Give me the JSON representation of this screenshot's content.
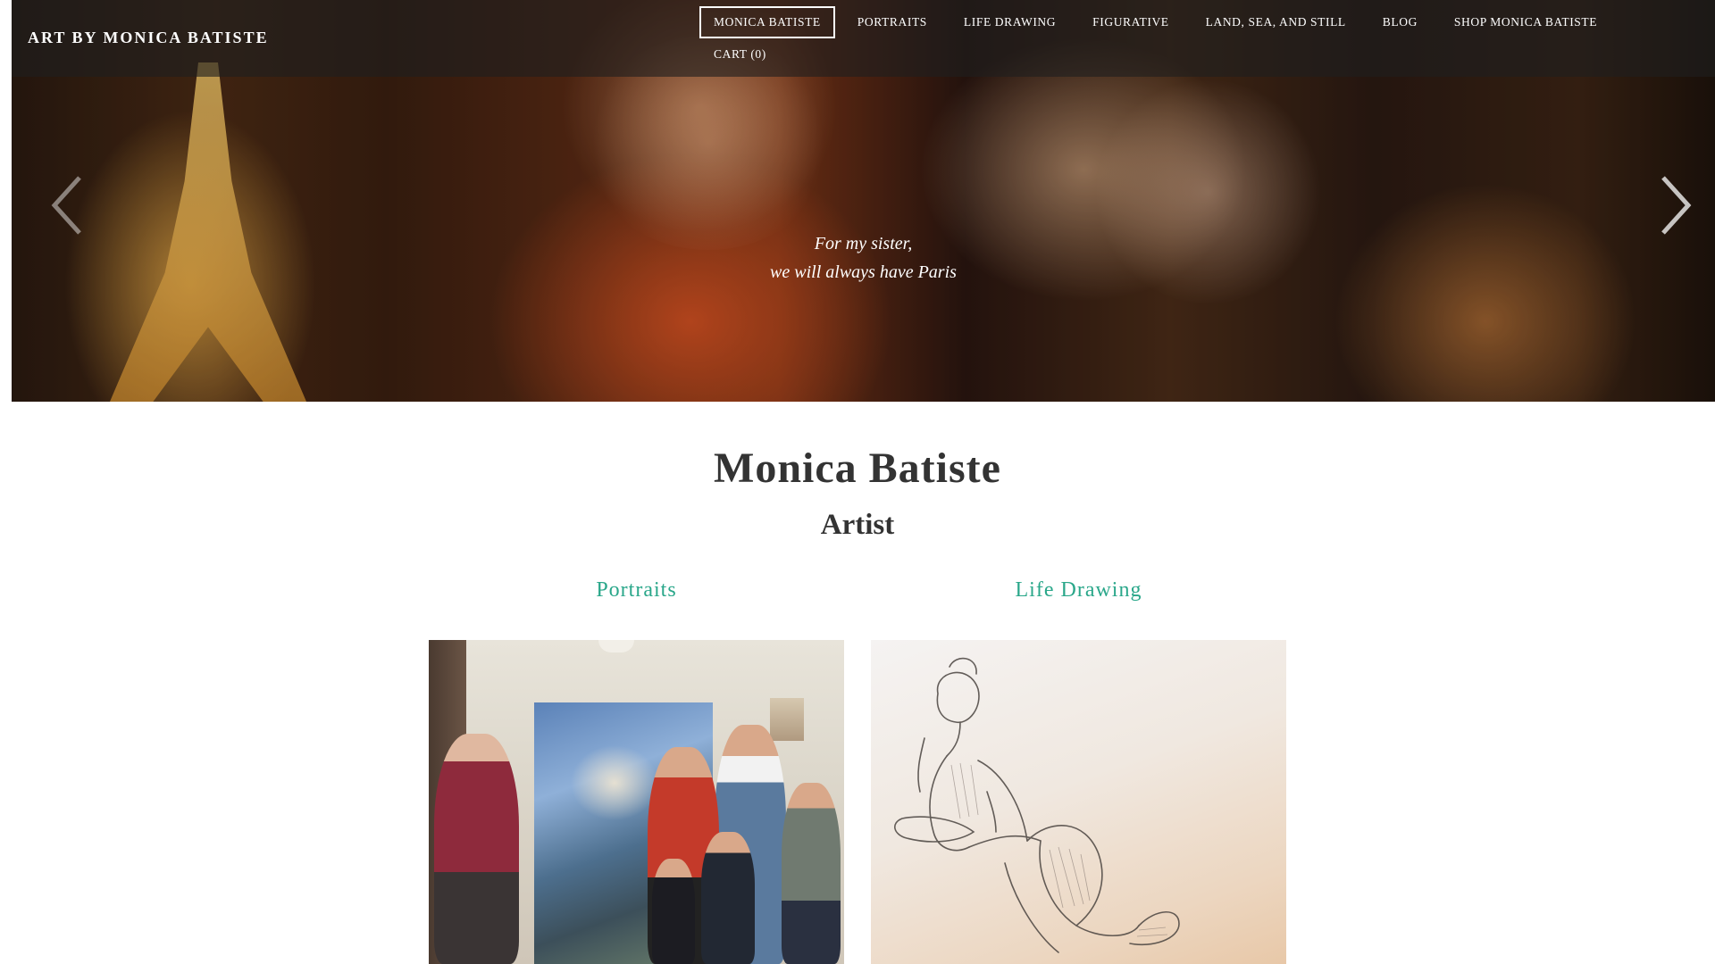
{
  "header": {
    "site_title": "ART BY MONICA BATISTE",
    "nav": [
      {
        "label": "MONICA BATISTE",
        "active": true
      },
      {
        "label": "PORTRAITS",
        "active": false
      },
      {
        "label": "LIFE DRAWING",
        "active": false
      },
      {
        "label": "FIGURATIVE",
        "active": false
      },
      {
        "label": "LAND, SEA, AND STILL",
        "active": false
      },
      {
        "label": "BLOG",
        "active": false
      },
      {
        "label": "SHOP MONICA BATISTE",
        "active": false
      },
      {
        "label": "CART (0)",
        "active": false
      }
    ]
  },
  "hero": {
    "caption_line1": "For my sister,",
    "caption_line2": "we will always have Paris",
    "prev_icon": "chevron-left-icon",
    "next_icon": "chevron-right-icon"
  },
  "main": {
    "name": "Monica Batiste",
    "role": "Artist",
    "categories": [
      {
        "label": "Portraits"
      },
      {
        "label": "Life Drawing"
      }
    ]
  },
  "colors": {
    "accent": "#2aa78a",
    "text": "#333333",
    "header_bg": "rgba(30,30,30,0.62)"
  }
}
